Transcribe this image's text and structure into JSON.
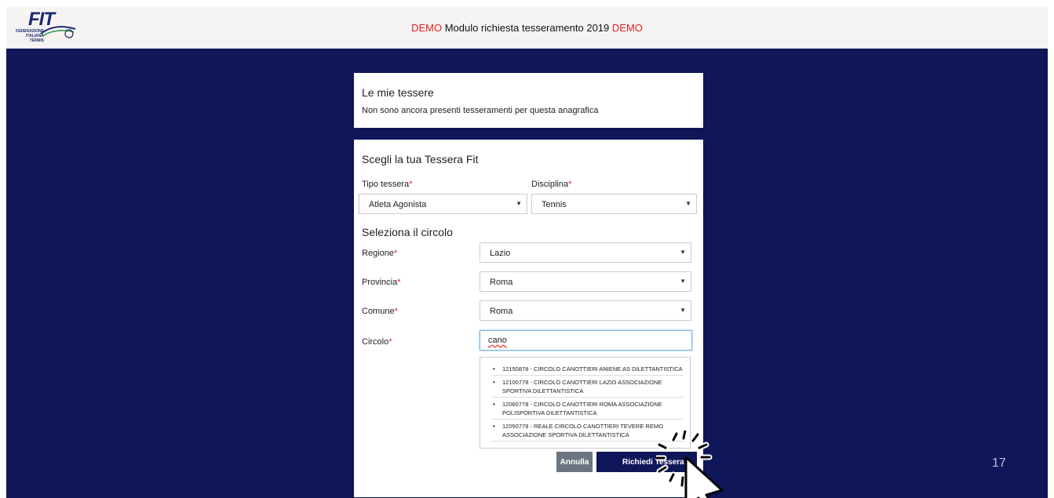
{
  "header": {
    "logo_text": "FIT",
    "logo_sub": "Federazione Italiana Tennis",
    "title_prefix": "DEMO",
    "title_main": " Modulo richiesta tesseramento 2019 ",
    "title_suffix": "DEMO"
  },
  "my_cards": {
    "title": "Le mie tessere",
    "message": "Non sono ancora presenti tesseramenti per questa anagrafica"
  },
  "form": {
    "title": "Scegli la tua Tessera Fit",
    "required_mark": "*",
    "tipo_tessera": {
      "label": "Tipo tessera",
      "value": "Atleta Agonista"
    },
    "disciplina": {
      "label": "Disciplina",
      "value": "Tennis"
    },
    "circle_section_title": "Seleziona il circolo",
    "regione": {
      "label": "Regione",
      "value": "Lazio"
    },
    "provincia": {
      "label": "Provincia",
      "value": "Roma"
    },
    "comune": {
      "label": "Comune",
      "value": "Roma"
    },
    "circolo": {
      "label": "Circolo",
      "value": "cano"
    },
    "suggestions": [
      "12150878 - CIRCOLO CANOTTIERI ANIENE AS DILETTANTISTICA",
      "12100778 - CIRCOLO CANOTTIERI LAZIO ASSOCIAZIONE SPORTIVA DILETTANTISTICA",
      "12060778 - CIRCOLO CANOTTIERI ROMA ASSOCIAZIONE POLISPORTIVA DILETTANTISTICA",
      "12050778 - REALE CIRCOLO CANOTTIERI TEVERE REMO ASSOCIAZIONE SPORTIVA DILETTANTISTICA"
    ],
    "cancel_label": "Annulla",
    "submit_label": "Richiedi Tessera"
  },
  "slide_number": "17",
  "colors": {
    "navy": "#0f1659",
    "demo_red": "#e02020",
    "cancel_grey": "#6b7582"
  }
}
